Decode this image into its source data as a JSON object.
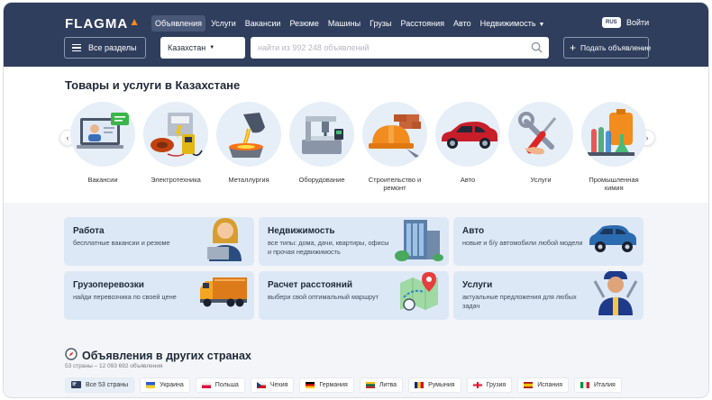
{
  "header": {
    "logo_text": "FLAGMA",
    "nav": [
      {
        "label": "Объявления",
        "active": true
      },
      {
        "label": "Услуги"
      },
      {
        "label": "Вакансии"
      },
      {
        "label": "Резюме"
      },
      {
        "label": "Машины"
      },
      {
        "label": "Грузы"
      },
      {
        "label": "Расстояния"
      },
      {
        "label": "Авто"
      },
      {
        "label": "Недвижимость"
      }
    ],
    "lang": "RUS",
    "login": "Войти",
    "all_sections": "Все разделы",
    "region": "Казахстан",
    "search_placeholder": "найти из 992 248 объявлений",
    "post_ad": "Подать объявление"
  },
  "categories": {
    "title": "Товары и услуги в Казахстане",
    "items": [
      {
        "label": "Вакансии",
        "icon": "laptop-person-icon"
      },
      {
        "label": "Электротехника",
        "icon": "electrical-meter-icon"
      },
      {
        "label": "Металлургия",
        "icon": "molten-metal-icon"
      },
      {
        "label": "Оборудование",
        "icon": "cnc-machine-icon"
      },
      {
        "label": "Строительство и ремонт",
        "icon": "hardhat-bricks-icon"
      },
      {
        "label": "Авто",
        "icon": "red-car-icon"
      },
      {
        "label": "Услуги",
        "icon": "wrench-screwdriver-icon"
      },
      {
        "label": "Промышленная химия",
        "icon": "chemistry-flasks-icon"
      }
    ]
  },
  "services": [
    {
      "title": "Работа",
      "subtitle": "бесплатные вакансии и резюме",
      "icon": "woman-laptop-icon"
    },
    {
      "title": "Недвижимость",
      "subtitle": "все типы: дома, дачи, квартиры, офисы и прочая недвижимость",
      "icon": "building-icon"
    },
    {
      "title": "Авто",
      "subtitle": "новые и б/у автомобили любой модели",
      "icon": "suv-icon"
    },
    {
      "title": "Грузоперевозки",
      "subtitle": "найди перевозчика по своей цене",
      "icon": "truck-icon"
    },
    {
      "title": "Расчет расстояний",
      "subtitle": "выбери свой оптимальный маршрут",
      "icon": "map-pin-icon"
    },
    {
      "title": "Услуги",
      "subtitle": "актуальные предложения для любых задач",
      "icon": "mechanic-icon"
    }
  ],
  "countries": {
    "title": "Объявления в других странах",
    "subtitle": "53 страны – 12 093 692 объявления",
    "chips": [
      {
        "label": "Все 53 страны"
      },
      {
        "label": "Украина",
        "colors": [
          "#2d5bd7",
          "#f5cf2e"
        ]
      },
      {
        "label": "Польша",
        "colors": [
          "#ffffff",
          "#dc143c"
        ]
      },
      {
        "label": "Чехия",
        "colors": [
          "#ffffff",
          "#d7141a",
          "#11457e"
        ]
      },
      {
        "label": "Германия",
        "colors": [
          "#000000",
          "#dd0000",
          "#ffce00"
        ]
      },
      {
        "label": "Литва",
        "colors": [
          "#fdb913",
          "#006a44",
          "#c1272d"
        ]
      },
      {
        "label": "Румыния",
        "colors": [
          "#002b7f",
          "#fcd116",
          "#ce1126"
        ]
      },
      {
        "label": "Грузия",
        "colors": [
          "#ffffff",
          "#e8112d"
        ]
      },
      {
        "label": "Испания",
        "colors": [
          "#aa151b",
          "#f1bf00"
        ]
      },
      {
        "label": "Италия",
        "colors": [
          "#009246",
          "#ffffff",
          "#ce2b37"
        ]
      }
    ]
  },
  "colors": {
    "header_bg": "#2f3e5c",
    "accent": "#ff8a1e",
    "card_bg": "#dde8f7"
  }
}
